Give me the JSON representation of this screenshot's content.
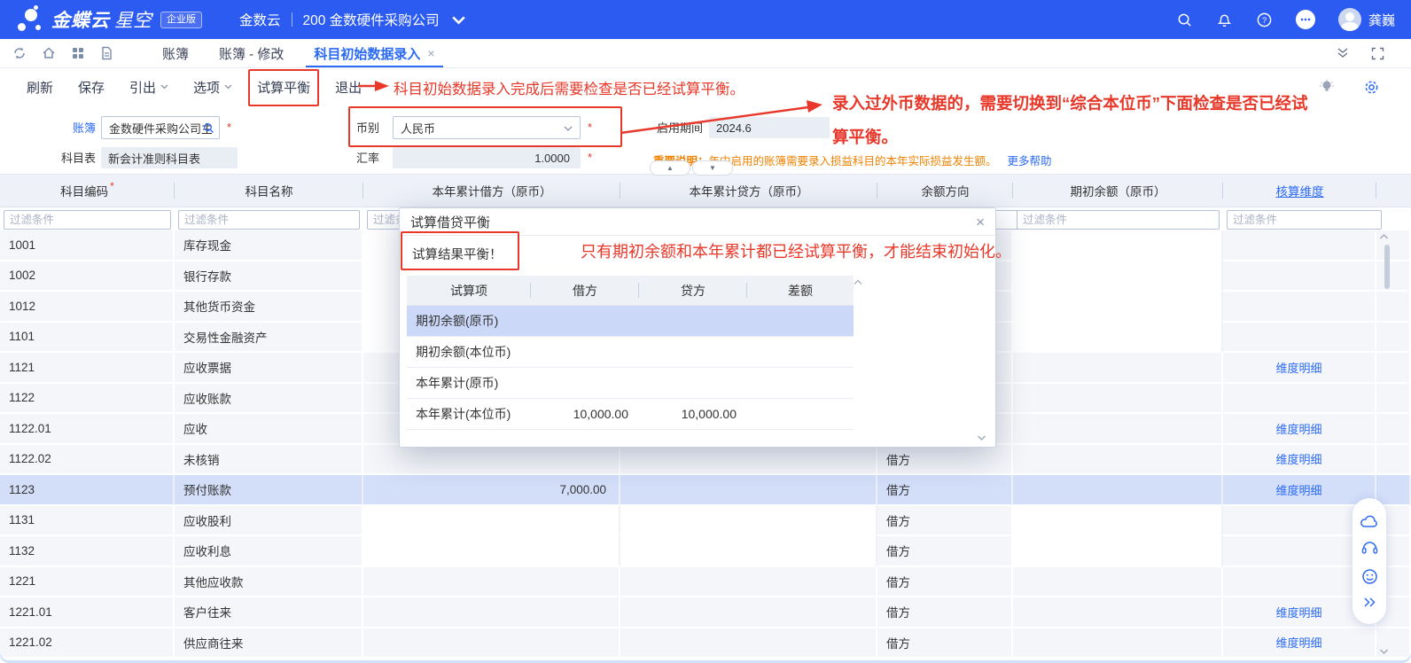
{
  "topbar": {
    "brand_primary": "金蝶云",
    "brand_secondary": "星空",
    "edition_badge": "企业版",
    "workspace": "金数云",
    "company": "200 金数硬件采购公司",
    "user_name": "龚巍"
  },
  "tabbar": {
    "tabs": [
      {
        "label": "账簿",
        "active": false,
        "closable": false
      },
      {
        "label": "账簿 - 修改",
        "active": false,
        "closable": false
      },
      {
        "label": "科目初始数据录入",
        "active": true,
        "closable": true
      }
    ]
  },
  "toolbar": {
    "buttons": [
      {
        "label": "刷新",
        "dropdown": false,
        "boxed": false
      },
      {
        "label": "保存",
        "dropdown": false,
        "boxed": false
      },
      {
        "label": "引出",
        "dropdown": true,
        "boxed": false
      },
      {
        "label": "选项",
        "dropdown": true,
        "boxed": false
      },
      {
        "label": "试算平衡",
        "dropdown": false,
        "boxed": true
      },
      {
        "label": "退出",
        "dropdown": false,
        "boxed": false
      }
    ]
  },
  "form": {
    "ledger_label": "账簿",
    "ledger_value": "金数硬件采购公司主...",
    "chart_label": "科目表",
    "chart_value": "新会计准则科目表",
    "currency_label": "币别",
    "currency_value": "人民币",
    "rate_label": "汇率",
    "rate_value": "1.0000",
    "period_label": "启用期间",
    "period_value": "2024.6",
    "notice_label": "重要说明：",
    "notice_text": "年中启用的账簿需要录入损益科目的本年实际损益发生额。",
    "help_link": "更多帮助",
    "required_mark": "*"
  },
  "annotations": {
    "toolbar_note": "科目初始数据录入完成后需要检查是否已经试算平衡。",
    "currency_note_line1": "录入过外币数据的，需要切换到“综合本位币”下面检查是否已经试",
    "currency_note_line2": "算平衡。",
    "dialog_note": "只有期初余额和本年累计都已经试算平衡，才能结束初始化。"
  },
  "grid": {
    "columns": [
      {
        "label": "科目编码",
        "required": true,
        "link": false
      },
      {
        "label": "科目名称",
        "required": false,
        "link": false
      },
      {
        "label": "本年累计借方（原币）",
        "required": false,
        "link": false
      },
      {
        "label": "本年累计贷方（原币）",
        "required": false,
        "link": false
      },
      {
        "label": "余额方向",
        "required": false,
        "link": false
      },
      {
        "label": "期初余额（原币）",
        "required": false,
        "link": false
      },
      {
        "label": "核算维度",
        "required": false,
        "link": true
      }
    ],
    "filter_placeholder": "过滤条件",
    "dim_link_label": "维度明细",
    "rows": [
      {
        "code": "1001",
        "name": "库存现金",
        "debit": "",
        "credit": "",
        "dir": "借方",
        "opening": "",
        "dim": false,
        "selected": false,
        "editable": true
      },
      {
        "code": "1002",
        "name": "银行存款",
        "debit": "",
        "credit": "",
        "dir": "借方",
        "opening": "",
        "dim": false,
        "selected": false,
        "editable": true
      },
      {
        "code": "1012",
        "name": "其他货币资金",
        "debit": "",
        "credit": "",
        "dir": "借方",
        "opening": "",
        "dim": false,
        "selected": false,
        "editable": true
      },
      {
        "code": "1101",
        "name": "交易性金融资产",
        "debit": "",
        "credit": "",
        "dir": "借方",
        "opening": "",
        "dim": false,
        "selected": false,
        "editable": true
      },
      {
        "code": "1121",
        "name": "应收票据",
        "debit": "",
        "credit": "",
        "dir": "借方",
        "opening": "",
        "dim": true,
        "selected": false,
        "editable": false
      },
      {
        "code": "1122",
        "name": "应收账款",
        "debit": "",
        "credit": "",
        "dir": "借方",
        "opening": "",
        "dim": false,
        "selected": false,
        "editable": false
      },
      {
        "code": "1122.01",
        "name": "应收",
        "debit": "",
        "credit": "",
        "dir": "借方",
        "opening": "",
        "dim": true,
        "selected": false,
        "editable": false
      },
      {
        "code": "1122.02",
        "name": "未核销",
        "debit": "",
        "credit": "",
        "dir": "借方",
        "opening": "",
        "dim": true,
        "selected": false,
        "editable": false
      },
      {
        "code": "1123",
        "name": "预付账款",
        "debit": "7,000.00",
        "credit": "",
        "dir": "借方",
        "opening": "",
        "dim": true,
        "selected": true,
        "editable": false
      },
      {
        "code": "1131",
        "name": "应收股利",
        "debit": "",
        "credit": "",
        "dir": "借方",
        "opening": "",
        "dim": false,
        "selected": false,
        "editable": true
      },
      {
        "code": "1132",
        "name": "应收利息",
        "debit": "",
        "credit": "",
        "dir": "借方",
        "opening": "",
        "dim": false,
        "selected": false,
        "editable": true
      },
      {
        "code": "1221",
        "name": "其他应收款",
        "debit": "",
        "credit": "",
        "dir": "借方",
        "opening": "",
        "dim": false,
        "selected": false,
        "editable": false
      },
      {
        "code": "1221.01",
        "name": "客户往来",
        "debit": "",
        "credit": "",
        "dir": "借方",
        "opening": "",
        "dim": true,
        "selected": false,
        "editable": false
      },
      {
        "code": "1221.02",
        "name": "供应商往来",
        "debit": "",
        "credit": "",
        "dir": "借方",
        "opening": "",
        "dim": true,
        "selected": false,
        "editable": false
      }
    ]
  },
  "dialog": {
    "title": "试算借贷平衡",
    "result_text": "试算结果平衡！",
    "columns": [
      "试算项",
      "借方",
      "贷方",
      "差额"
    ],
    "rows": [
      {
        "item": "期初余额(原币)",
        "debit": "",
        "credit": "",
        "diff": "",
        "selected": true
      },
      {
        "item": "期初余额(本位币)",
        "debit": "",
        "credit": "",
        "diff": "",
        "selected": false
      },
      {
        "item": "本年累计(原币)",
        "debit": "",
        "credit": "",
        "diff": "",
        "selected": false
      },
      {
        "item": "本年累计(本位币)",
        "debit": "10,000.00",
        "credit": "10,000.00",
        "diff": "",
        "selected": false
      }
    ]
  },
  "colors": {
    "topbar_blue": "#2b5bf0",
    "accent_blue": "#2a6af5",
    "annotation_red": "#e8382a",
    "notice_orange": "#ef8201",
    "selected_row": "#d3def9"
  }
}
